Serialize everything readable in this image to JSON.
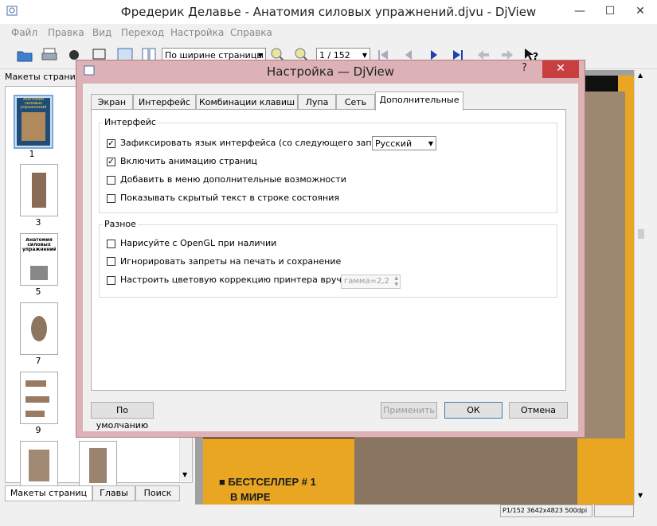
{
  "window": {
    "title": "Фредерик Делавье - Анатомия силовых упражнений.djvu - DjView",
    "minimize": "—",
    "maximize": "☐",
    "close": "✕"
  },
  "menu": [
    "Файл",
    "Правка",
    "Вид",
    "Переход",
    "Настройка",
    "Справка"
  ],
  "toolbar": {
    "zoom_mode": "По ширине страницы",
    "page_indicator": "1 / 152"
  },
  "sidebar": {
    "header": "Макеты страниц",
    "thumbnails": [
      {
        "label": "1",
        "cover_title": "Анатомия силовых упражнений"
      },
      {
        "label": "3"
      },
      {
        "label": "5",
        "cover_title": "Анатомия силовых упражнений"
      },
      {
        "label": "7"
      },
      {
        "label": "9"
      },
      {
        "label": ""
      },
      {
        "label": ""
      }
    ],
    "tabs": [
      "Макеты страниц",
      "Главы",
      "Поиск"
    ]
  },
  "document": {
    "cover_line1": "■ БЕСТСЕЛЛЕР  # 1",
    "cover_line2": "В МИРЕ"
  },
  "status": {
    "text": "P1/152 3642x4823 500dpi"
  },
  "dialog": {
    "title": "Настройка — DjView",
    "help": "?",
    "close": "✕",
    "tabs": [
      "Экран",
      "Интерфейс",
      "Комбинации клавиш",
      "Лупа",
      "Сеть",
      "Дополнительные"
    ],
    "active_tab": "Дополнительные",
    "group_interface": {
      "label": "Интерфейс",
      "items": [
        {
          "label": "Зафиксировать язык интерфейса (со следующего запуска)",
          "checked": true
        },
        {
          "label": "Включить анимацию страниц",
          "checked": true
        },
        {
          "label": "Добавить в меню дополнительные возможности",
          "checked": false
        },
        {
          "label": "Показывать скрытый текст в строке состояния",
          "checked": false
        }
      ],
      "language": "Русский"
    },
    "group_misc": {
      "label": "Разное",
      "items": [
        {
          "label": "Нарисуйте с OpenGL при наличии",
          "checked": false
        },
        {
          "label": "Игнорировать запреты на печать и сохранение",
          "checked": false
        },
        {
          "label": "Настроить цветовую коррекцию принтера вручную",
          "checked": false
        }
      ],
      "gamma": "гамма=2,2"
    },
    "buttons": {
      "defaults": "По умолчанию",
      "apply": "Применить",
      "ok": "ОК",
      "cancel": "Отмена"
    }
  }
}
